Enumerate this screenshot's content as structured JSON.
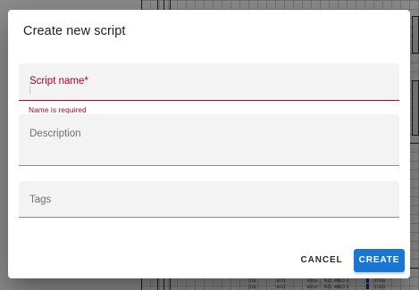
{
  "dialog": {
    "title": "Create new script",
    "fields": {
      "script_name": {
        "label": "Script name*",
        "value": "",
        "error": "Name is required"
      },
      "description": {
        "label": "Description",
        "value": ""
      },
      "tags": {
        "label": "Tags",
        "value": ""
      }
    },
    "actions": {
      "cancel_label": "CANCEL",
      "create_label": "CREATE"
    }
  },
  "colors": {
    "accent": "#1976d2",
    "error": "#b0002a",
    "field_bg": "#f3f3f3"
  }
}
